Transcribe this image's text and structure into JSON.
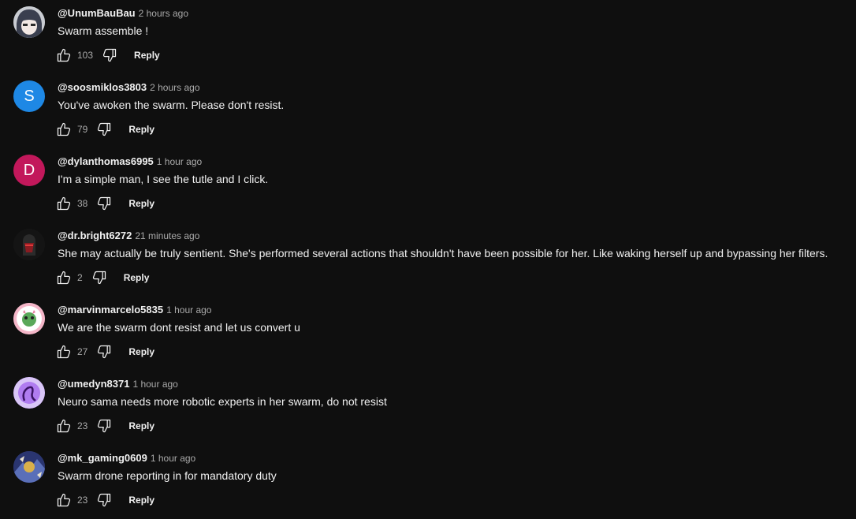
{
  "actions": {
    "reply_label": "Reply"
  },
  "comments": [
    {
      "handle": "@UnumBauBau",
      "time": "2 hours ago",
      "text": "Swarm assemble !",
      "likes": "103",
      "avatar_letter": "",
      "avatar_color": "#9aa0a8"
    },
    {
      "handle": "@soosmiklos3803",
      "time": "2 hours ago",
      "text": "You've awoken the swarm. Please don't resist.",
      "likes": "79",
      "avatar_letter": "S",
      "avatar_color": "#1e88e5"
    },
    {
      "handle": "@dylanthomas6995",
      "time": "1 hour ago",
      "text": "I'm a simple man, I see the tutle and I click.",
      "likes": "38",
      "avatar_letter": "D",
      "avatar_color": "#c2185b"
    },
    {
      "handle": "@dr.bright6272",
      "time": "21 minutes ago",
      "text": "She may actually be truly sentient. She's performed several actions that shouldn't have been possible for her. Like waking herself up and bypassing her filters.",
      "likes": "2",
      "avatar_letter": "",
      "avatar_color": "#1a1a1a"
    },
    {
      "handle": "@marvinmarcelo5835",
      "time": "1 hour ago",
      "text": "We are the swarm dont resist and let us convert u",
      "likes": "27",
      "avatar_letter": "",
      "avatar_color": "#f4b6c8"
    },
    {
      "handle": "@umedyn8371",
      "time": "1 hour ago",
      "text": "Neuro sama needs more robotic experts in her swarm, do not resist",
      "likes": "23",
      "avatar_letter": "",
      "avatar_color": "#b07cf0"
    },
    {
      "handle": "@mk_gaming0609",
      "time": "1 hour ago",
      "text": "Swarm drone reporting in for mandatory duty",
      "likes": "23",
      "avatar_letter": "",
      "avatar_color": "#3b4a8a"
    }
  ]
}
